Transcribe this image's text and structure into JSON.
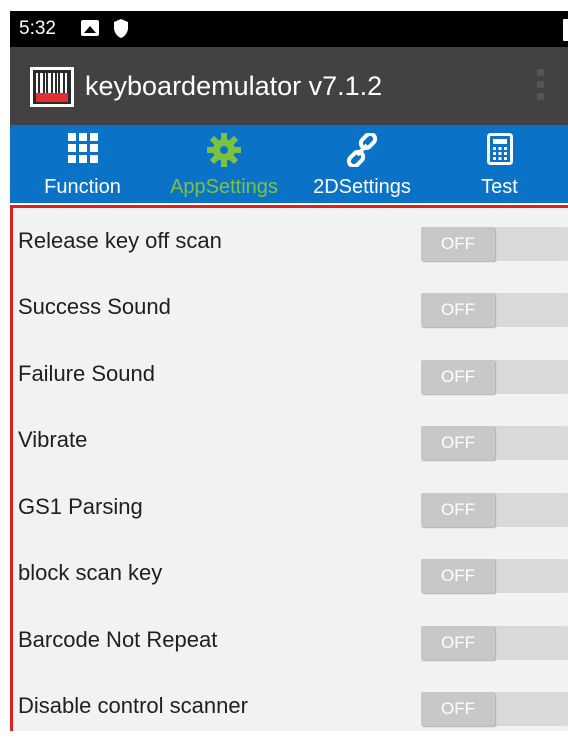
{
  "status_bar": {
    "time": "5:32",
    "icons": [
      "image-icon",
      "shield-icon",
      "battery-icon"
    ]
  },
  "app_bar": {
    "title": "keyboardemulator v7.1.2",
    "logo_icon": "barcode-logo-icon",
    "menu_icon": "overflow-menu-icon"
  },
  "tabs": [
    {
      "label": "Function",
      "icon": "grid-icon",
      "active": false
    },
    {
      "label": "AppSettings",
      "icon": "gear-icon",
      "active": true
    },
    {
      "label": "2DSettings",
      "icon": "link-icon",
      "active": false
    },
    {
      "label": "Test",
      "icon": "calculator-icon",
      "active": false
    }
  ],
  "settings": [
    {
      "label": "Release key off scan",
      "toggle": "OFF"
    },
    {
      "label": "Success Sound",
      "toggle": "OFF"
    },
    {
      "label": "Failure Sound",
      "toggle": "OFF"
    },
    {
      "label": "Vibrate",
      "toggle": "OFF"
    },
    {
      "label": "GS1 Parsing",
      "toggle": "OFF"
    },
    {
      "label": "block scan key",
      "toggle": "OFF"
    },
    {
      "label": "Barcode Not Repeat",
      "toggle": "OFF"
    },
    {
      "label": "Disable control scanner",
      "toggle": "OFF"
    }
  ],
  "colors": {
    "status_bar": "#000000",
    "app_bar": "#424242",
    "tab_bar": "#0a73c7",
    "active_tab": "#7cc242",
    "highlight_border": "#e02020",
    "panel_bg": "#f2f2f2"
  }
}
